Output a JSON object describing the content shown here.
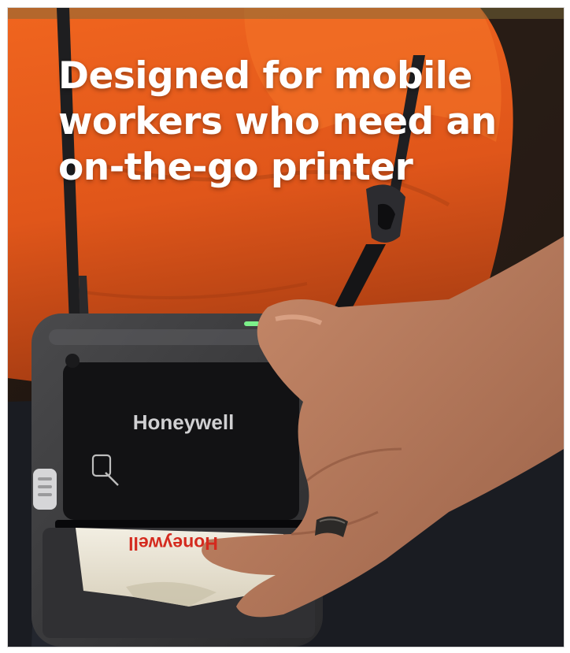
{
  "headline": {
    "lines": [
      "Designed for mobile",
      "workers who need an",
      "on-the-go printer"
    ]
  },
  "printer": {
    "brand_label": "Honeywell",
    "receipt_text": "Honeywell"
  },
  "colors": {
    "vest_orange": "#e4571a",
    "printer_body": "#3a3a3c",
    "printer_face": "#121214",
    "receipt_red": "#d42a1e"
  }
}
